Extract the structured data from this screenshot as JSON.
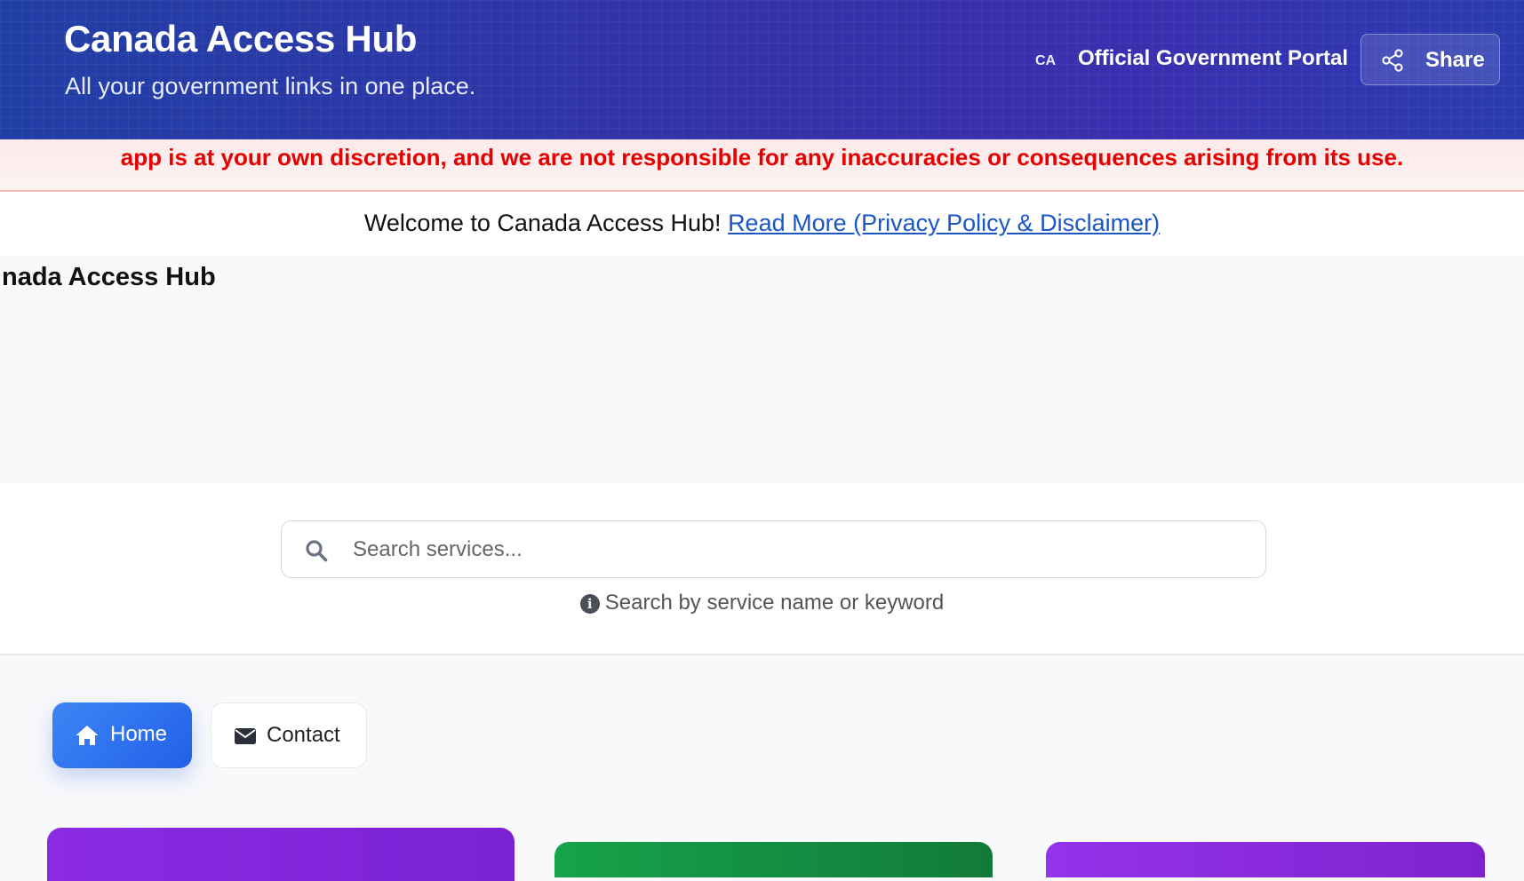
{
  "header": {
    "title": "Canada Access Hub",
    "subtitle": "All your government links in one place.",
    "country_code": "CA",
    "portal_label": "Official Government Portal",
    "share_label": "Share"
  },
  "disclaimer": {
    "text": "app is at your own discretion, and we are not responsible for any inaccuracies or consequences arising from its use.",
    "color": "#e60000"
  },
  "welcome": {
    "text": "Welcome to Canada Access Hub!",
    "link_label": "Read More (Privacy Policy & Disclaimer)"
  },
  "content": {
    "cut_title": "nada Access Hub"
  },
  "search": {
    "placeholder": "Search services...",
    "value": "",
    "hint": "Search by service name or keyword"
  },
  "nav": {
    "home_label": "Home",
    "contact_label": "Contact",
    "active": "Home",
    "accent": "#2a68ea"
  },
  "icons": {
    "share": "share-icon",
    "search": "search-icon",
    "info": "info-icon",
    "home": "home-icon",
    "envelope": "envelope-icon"
  },
  "cards": {
    "colors": [
      "#8a2be2",
      "#16a34a",
      "#9333ea"
    ]
  }
}
